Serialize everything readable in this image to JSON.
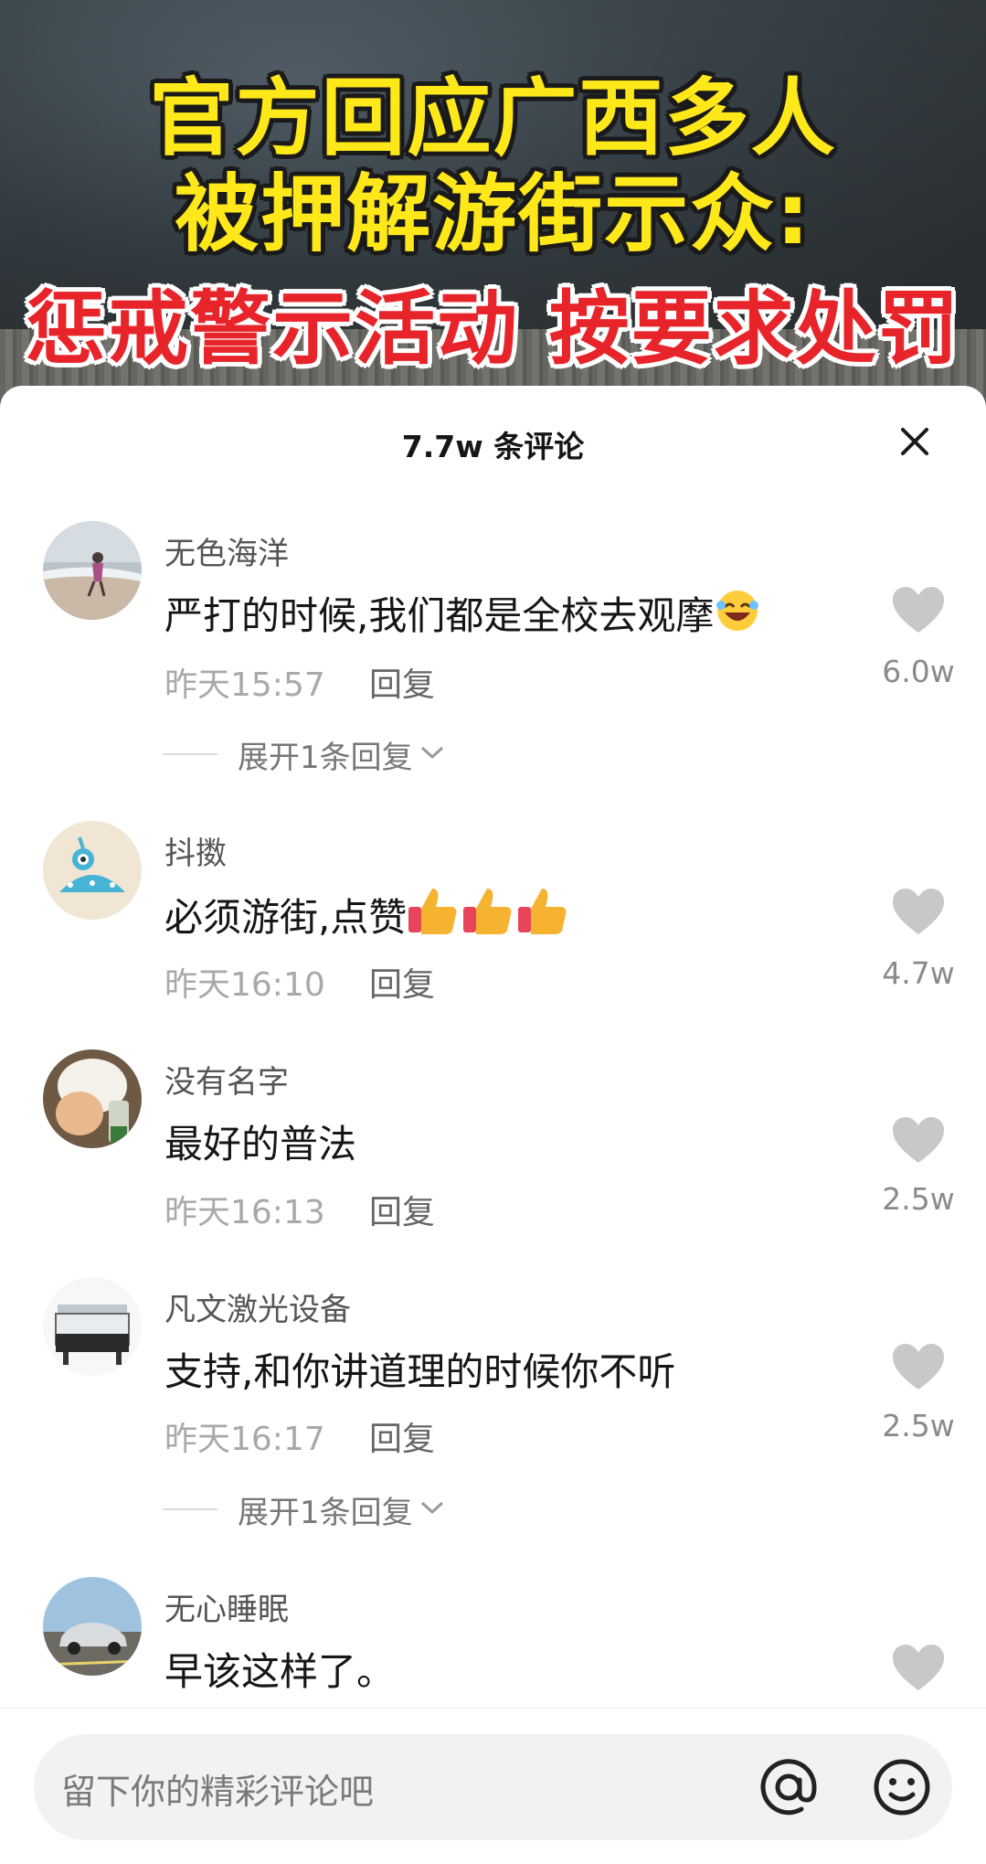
{
  "video": {
    "title_line1": "官方回应广西多人",
    "title_line2": "被押解游街示众:",
    "title_line3": "惩戒警示活动 按要求处罚"
  },
  "comments_panel": {
    "count_title": "7.7w 条评论",
    "close_icon": "close-icon"
  },
  "comments": [
    {
      "username": "无色海洋",
      "text": "严打的时候,我们都是全校去观摩",
      "emoji": "rolling-laughing-emoji",
      "time": "昨天15:57",
      "reply_label": "回复",
      "likes": "6.0w",
      "expand_label": "展开1条回复"
    },
    {
      "username": "抖擞",
      "text": "必须游街,点赞",
      "emoji": "thumbs-up-emoji",
      "time": "昨天16:10",
      "reply_label": "回复",
      "likes": "4.7w"
    },
    {
      "username": "没有名字",
      "text": "最好的普法",
      "time": "昨天16:13",
      "reply_label": "回复",
      "likes": "2.5w"
    },
    {
      "username": "凡文激光设备",
      "text": "支持,和你讲道理的时候你不听",
      "time": "昨天16:17",
      "reply_label": "回复",
      "likes": "2.5w",
      "expand_label": "展开1条回复"
    },
    {
      "username": "无心睡眠",
      "text": "早该这样了。"
    }
  ],
  "input": {
    "placeholder": "留下你的精彩评论吧",
    "mention_icon": "at-icon",
    "emoji_icon": "emoji-icon"
  },
  "colors": {
    "title_yellow": "#ffe81a",
    "title_red": "#e8242b",
    "like_gray": "#c8c8c8",
    "meta_gray": "#a9a9a9"
  }
}
